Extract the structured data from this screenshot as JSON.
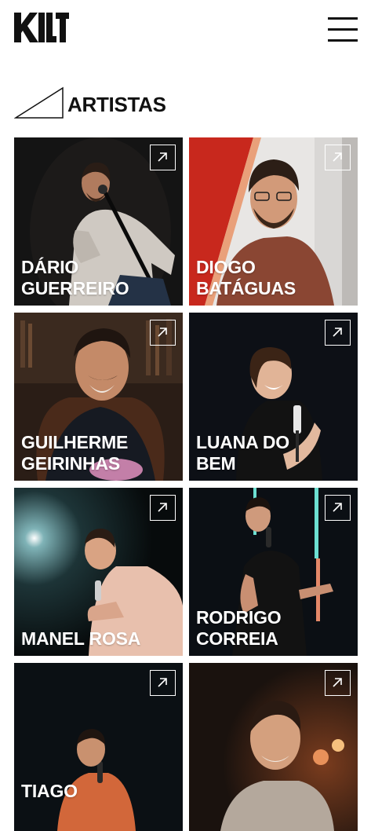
{
  "header": {
    "logo_text": "KILT",
    "menu_icon": "hamburger-icon"
  },
  "section": {
    "title": "ARTISTAS",
    "decor_icon": "triangle-outline-icon"
  },
  "artists": [
    {
      "line1": "DÁRIO",
      "line2": "GUERREIRO",
      "icon": "arrow-up-right-icon"
    },
    {
      "line1": "DIOGO",
      "line2": "BATÁGUAS",
      "icon": "arrow-up-right-icon"
    },
    {
      "line1": "GUILHERME",
      "line2": "GEIRINHAS",
      "icon": "arrow-up-right-icon"
    },
    {
      "line1": "LUANA DO",
      "line2": "BEM",
      "icon": "arrow-up-right-icon"
    },
    {
      "line1": "MANEL ROSA",
      "line2": "",
      "icon": "arrow-up-right-icon"
    },
    {
      "line1": "RODRIGO",
      "line2": "CORREIA",
      "icon": "arrow-up-right-icon"
    },
    {
      "line1": "TIAGO",
      "line2": "",
      "icon": "arrow-up-right-icon"
    },
    {
      "line1": "",
      "line2": "",
      "icon": "arrow-up-right-icon"
    }
  ],
  "colors": {
    "text": "#111111",
    "background": "#ffffff",
    "card_overlay_text": "#ffffff"
  }
}
